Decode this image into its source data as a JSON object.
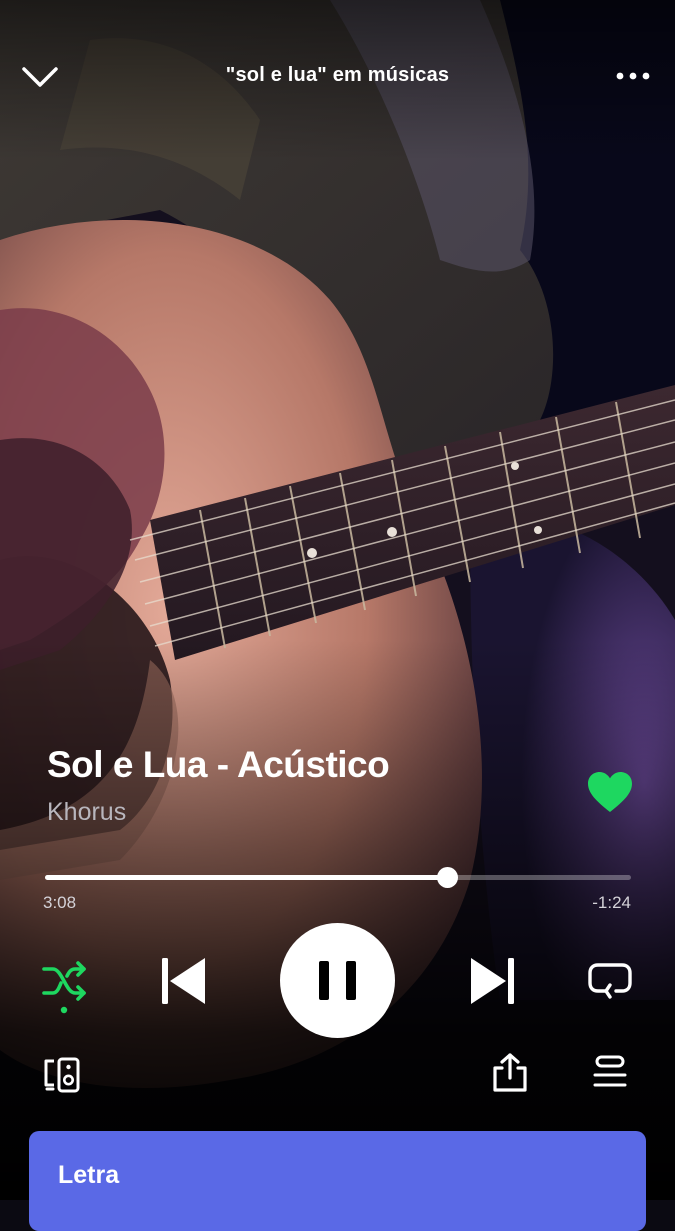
{
  "header": {
    "context_title": "\"sol e lua\" em músicas",
    "collapse_icon": "chevron-down-icon",
    "more_icon": "more-horizontal-icon"
  },
  "track": {
    "title": "Sol e Lua - Acústico",
    "artist": "Khorus",
    "liked": true
  },
  "playback": {
    "elapsed": "3:08",
    "remaining": "-1:24",
    "progress_fraction": 0.686,
    "is_playing": true,
    "shuffle_on": true,
    "repeat_on": false
  },
  "controls": {
    "shuffle_icon": "shuffle-icon",
    "previous_icon": "skip-previous-icon",
    "pause_icon": "pause-icon",
    "next_icon": "skip-next-icon",
    "repeat_icon": "repeat-icon",
    "devices_icon": "connect-devices-icon",
    "share_icon": "share-icon",
    "queue_icon": "queue-icon"
  },
  "lyrics": {
    "label": "Letra"
  },
  "colors": {
    "accent_green": "#1ed760",
    "lyrics_card": "#5a69e6",
    "background": "#0b0a12"
  }
}
